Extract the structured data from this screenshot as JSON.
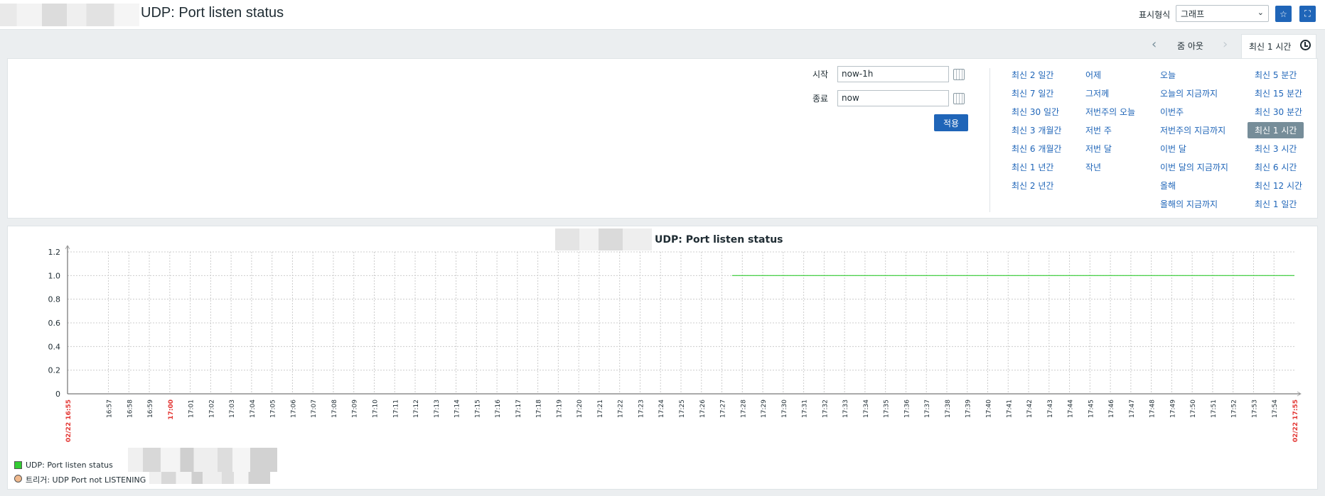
{
  "header": {
    "title": "UDP: Port listen status",
    "view_label": "표시형식",
    "view_select": "그래프"
  },
  "timenav": {
    "zoom_out": "줌 아웃",
    "active_tab": "최신 1 시간"
  },
  "filter": {
    "from_label": "시작",
    "from_value": "now-1h",
    "to_label": "종료",
    "to_value": "now",
    "apply": "적용",
    "quick": [
      [
        "최신 2 일간",
        "최신 7 일간",
        "최신 30 일간",
        "최신 3 개월간",
        "최신 6 개월간",
        "최신 1 년간",
        "최신 2 년간"
      ],
      [
        "어제",
        "그저께",
        "저번주의 오늘",
        "저번 주",
        "저번 달",
        "작년"
      ],
      [
        "오늘",
        "오늘의 지금까지",
        "이번주",
        "저번주의 지금까지",
        "이번 달",
        "이번 달의 지금까지",
        "올해",
        "올해의 지금까지"
      ],
      [
        "최신 5 분간",
        "최신 15 분간",
        "최신 30 분간",
        "최신 1 시간",
        "최신 3 시간",
        "최신 6 시간",
        "최신 12 시간",
        "최신 1 일간"
      ]
    ],
    "selected": "최신 1 시간"
  },
  "graph": {
    "title": "UDP: Port listen status",
    "legend": [
      {
        "label": "UDP: Port listen status",
        "color": "#33cc33"
      },
      {
        "label": "트리거: UDP Port not LISTENING",
        "color": "#f0b98d"
      }
    ]
  },
  "chart_data": {
    "type": "line",
    "title": "UDP: Port listen status",
    "xlabel": "",
    "ylabel": "",
    "ylim": [
      0,
      1.2
    ],
    "yticks": [
      "0",
      "0.2",
      "0.4",
      "0.6",
      "0.8",
      "1.0",
      "1.2"
    ],
    "x_start_label": "02/22 16:55",
    "x_end_label": "02/22 17:55",
    "xticks": [
      "16:57",
      "16:58",
      "16:59",
      "17:00",
      "17:01",
      "17:02",
      "17:03",
      "17:04",
      "17:05",
      "17:06",
      "17:07",
      "17:08",
      "17:09",
      "17:10",
      "17:11",
      "17:12",
      "17:13",
      "17:14",
      "17:15",
      "17:16",
      "17:17",
      "17:18",
      "17:19",
      "17:20",
      "17:21",
      "17:22",
      "17:23",
      "17:24",
      "17:25",
      "17:26",
      "17:27",
      "17:28",
      "17:29",
      "17:30",
      "17:31",
      "17:32",
      "17:33",
      "17:34",
      "17:35",
      "17:36",
      "17:37",
      "17:38",
      "17:39",
      "17:40",
      "17:41",
      "17:42",
      "17:43",
      "17:44",
      "17:45",
      "17:46",
      "17:47",
      "17:48",
      "17:49",
      "17:50",
      "17:51",
      "17:52",
      "17:53",
      "17:54",
      "17:55"
    ],
    "red_ticks": [
      "17:00"
    ],
    "series": [
      {
        "name": "UDP: Port listen status",
        "color": "#33cc33",
        "x": [
          "17:27:30",
          "17:55"
        ],
        "values": [
          1,
          1
        ]
      }
    ],
    "grid": true
  }
}
